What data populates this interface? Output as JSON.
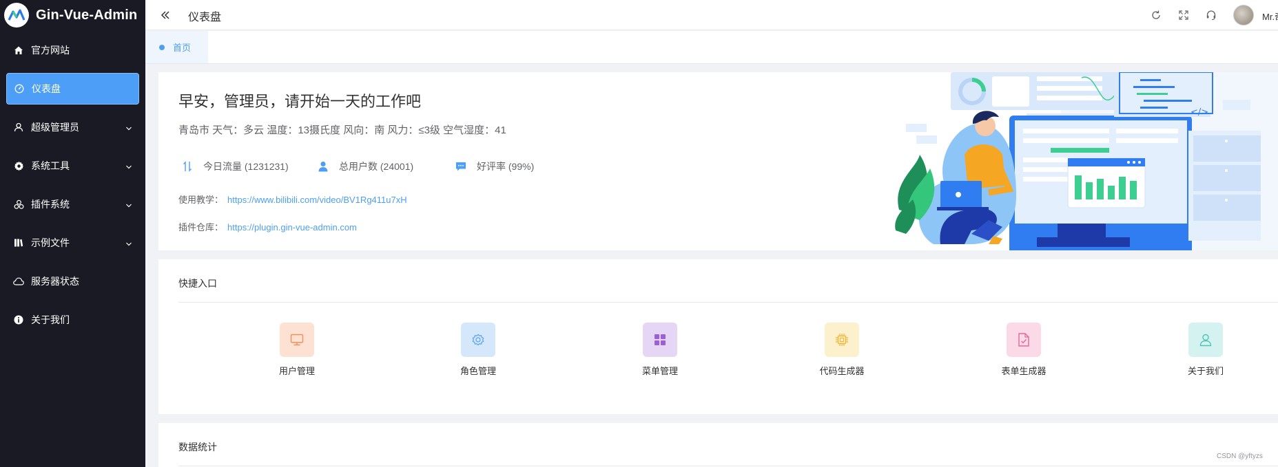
{
  "app": {
    "title": "Gin-Vue-Admin"
  },
  "sidebar": {
    "items": [
      {
        "label": "官方网站",
        "icon": "home-icon",
        "active": false,
        "expandable": false
      },
      {
        "label": "仪表盘",
        "icon": "dashboard-icon",
        "active": true,
        "expandable": false
      },
      {
        "label": "超级管理员",
        "icon": "user-icon",
        "active": false,
        "expandable": true
      },
      {
        "label": "系统工具",
        "icon": "gear-icon",
        "active": false,
        "expandable": true
      },
      {
        "label": "插件系统",
        "icon": "plugin-icon",
        "active": false,
        "expandable": true
      },
      {
        "label": "示例文件",
        "icon": "files-icon",
        "active": false,
        "expandable": true
      },
      {
        "label": "服务器状态",
        "icon": "cloud-icon",
        "active": false,
        "expandable": false
      },
      {
        "label": "关于我们",
        "icon": "info-icon",
        "active": false,
        "expandable": false
      }
    ]
  },
  "header": {
    "breadcrumb": "仪表盘",
    "icons": [
      "refresh-icon",
      "fullscreen-icon",
      "headset-icon"
    ],
    "username": "Mr.奇"
  },
  "tabs": [
    {
      "label": "首页",
      "active": true
    }
  ],
  "welcome": {
    "greeting": "早安，管理员，请开始一天的工作吧",
    "weather": "青岛市 天气：多云 温度：13摄氏度 风向：南 风力：≤3级 空气湿度：41",
    "stats": [
      {
        "label": "今日流量 (1231231)",
        "icon": "traffic-icon"
      },
      {
        "label": "总用户数 (24001)",
        "icon": "users-icon"
      },
      {
        "label": "好评率 (99%)",
        "icon": "chat-icon"
      }
    ],
    "tutorial_label": "使用教学：",
    "tutorial_link": "https://www.bilibili.com/video/BV1Rg411u7xH",
    "plugin_label": "插件仓库：",
    "plugin_link": "https://plugin.gin-vue-admin.com"
  },
  "quick": {
    "title": "快捷入口",
    "items": [
      {
        "label": "用户管理",
        "icon": "monitor-icon",
        "bg": "#fde2d3",
        "color": "#f28e5a"
      },
      {
        "label": "角色管理",
        "icon": "setting-icon",
        "bg": "#d5e8fb",
        "color": "#5aa6ee"
      },
      {
        "label": "菜单管理",
        "icon": "menu-grid-icon",
        "bg": "#e6d6f5",
        "color": "#9b5fd6"
      },
      {
        "label": "代码生成器",
        "icon": "cpu-icon",
        "bg": "#fdf0cc",
        "color": "#f0b73a"
      },
      {
        "label": "表单生成器",
        "icon": "document-check-icon",
        "bg": "#fcd9e6",
        "color": "#e4679a"
      },
      {
        "label": "关于我们",
        "icon": "user-outline-icon",
        "bg": "#d4f2ef",
        "color": "#4cc3b7"
      }
    ]
  },
  "statistics": {
    "title": "数据统计"
  },
  "watermark": "CSDN @yftyzs",
  "colors": {
    "sidebar_bg": "#191a23",
    "accent": "#4d9ef6"
  }
}
